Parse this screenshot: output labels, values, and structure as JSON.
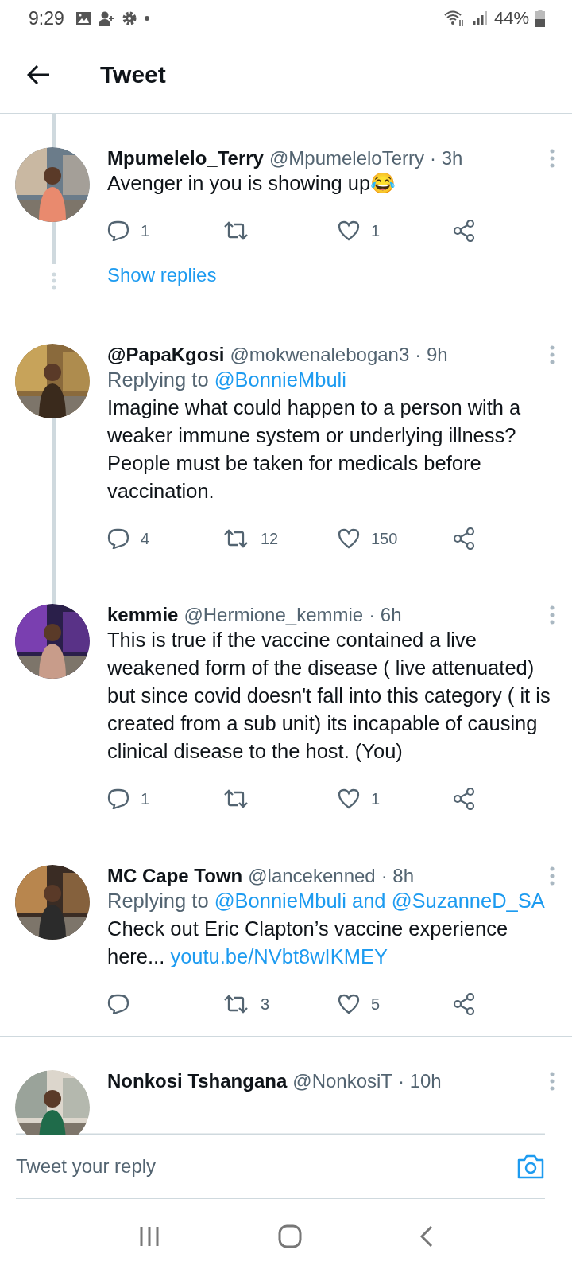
{
  "status_bar": {
    "time": "9:29",
    "battery": "44%"
  },
  "header": {
    "title": "Tweet"
  },
  "tweets": [
    {
      "name": "Mpumelelo_Terry",
      "handle": "@MpumeleloTerry",
      "time": "· 3h",
      "thread_above": true,
      "thread_below": true,
      "avatar": {
        "kind": "picture"
      },
      "body": [
        {
          "kind": "plain",
          "text": "Avenger in you is showing up😂"
        }
      ],
      "actions": {
        "replies": "1",
        "likes": "1"
      },
      "show_replies": "Show replies"
    },
    {
      "name": "@PapaKgosi",
      "handle": "@mokwenalebogan3",
      "time": "· 9h",
      "thread_above": false,
      "thread_below": true,
      "avatar": {
        "kind": "picture"
      },
      "replying_to": [
        {
          "kind": "plain",
          "text": "Replying to"
        },
        {
          "kind": "link",
          "text": "@BonnieMbuli"
        }
      ],
      "body": [
        {
          "kind": "plain",
          "text": "Imagine what could happen to a person with a weaker immune system or underlying illness?\nPeople must be taken for medicals before vaccination."
        }
      ],
      "actions": {
        "replies": "4",
        "retweets": "12",
        "likes": "150"
      }
    },
    {
      "name": "kemmie",
      "handle": "@Hermione_kemmie",
      "time": "· 6h",
      "thread_above": true,
      "thread_below": false,
      "avatar": {
        "kind": "picture"
      },
      "body": [
        {
          "kind": "plain",
          "text": "This is true if the vaccine contained a live weakened form of the disease ( live attenuated) but since covid  doesn't fall into this category (  it is created from a sub unit) its incapable of causing clinical disease to the host. (You)"
        }
      ],
      "actions": {
        "replies": "1",
        "likes": "1"
      }
    },
    {
      "name": "MC Cape Town",
      "handle": "@lancekenned",
      "time": "· 8h",
      "thread_above": false,
      "thread_below": false,
      "avatar": {
        "kind": "picture"
      },
      "replying_to": [
        {
          "kind": "plain",
          "text": "Replying to"
        },
        {
          "kind": "link",
          "text": "@BonnieMbuli"
        },
        {
          "kind": "link",
          "text": "and"
        },
        {
          "kind": "link",
          "text": "@SuzanneD_SA"
        }
      ],
      "body": [
        {
          "kind": "plain",
          "text": "Check out Eric Clapton’s vaccine experience here..."
        },
        {
          "kind": "link",
          "text": "youtu.be/NVbt8wIKMEY"
        }
      ],
      "actions": {
        "retweets": "3",
        "likes": "5"
      }
    },
    {
      "name": "Nonkosi Tshangana",
      "handle": "@NonkosiT",
      "time": "· 10h",
      "thread_above": false,
      "thread_below": false,
      "avatar": {
        "kind": "picture"
      }
    }
  ],
  "reply_bar": {
    "placeholder": "Tweet your reply"
  }
}
